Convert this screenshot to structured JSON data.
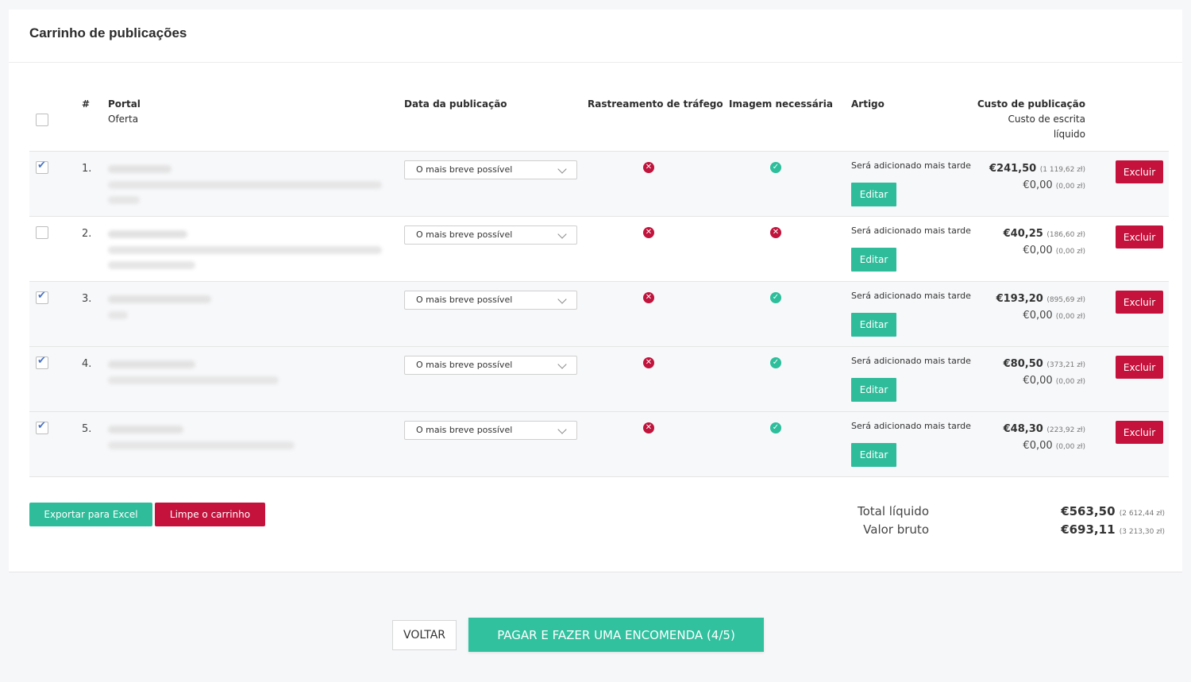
{
  "card": {
    "title": "Carrinho de publicações"
  },
  "headers": {
    "hash": "#",
    "portal": "Portal",
    "oferta": "Oferta",
    "date": "Data da publicação",
    "tracking": "Rastreamento de tráfego",
    "image": "Imagem necessária",
    "article": "Artigo",
    "cost": "Custo de publicação",
    "writing_cost": "Custo de escrita",
    "net": "líquido"
  },
  "rows": [
    {
      "checked": true,
      "num": "1.",
      "date": "O mais breve possível",
      "tracking": "no",
      "image": "yes",
      "article": "Será adicionado mais tarde",
      "edit": "Editar",
      "price": "€241,50",
      "price_pln": "(1 119,62 zł)",
      "writing": "€0,00",
      "writing_pln": "(0,00 zł)",
      "delete": "Excluir"
    },
    {
      "checked": false,
      "num": "2.",
      "date": "O mais breve possível",
      "tracking": "no",
      "image": "no",
      "article": "Será adicionado mais tarde",
      "edit": "Editar",
      "price": "€40,25",
      "price_pln": "(186,60 zł)",
      "writing": "€0,00",
      "writing_pln": "(0,00 zł)",
      "delete": "Excluir"
    },
    {
      "checked": true,
      "num": "3.",
      "date": "O mais breve possível",
      "tracking": "no",
      "image": "yes",
      "article": "Será adicionado mais tarde",
      "edit": "Editar",
      "price": "€193,20",
      "price_pln": "(895,69 zł)",
      "writing": "€0,00",
      "writing_pln": "(0,00 zł)",
      "delete": "Excluir"
    },
    {
      "checked": true,
      "num": "4.",
      "date": "O mais breve possível",
      "tracking": "no",
      "image": "yes",
      "article": "Será adicionado mais tarde",
      "edit": "Editar",
      "price": "€80,50",
      "price_pln": "(373,21 zł)",
      "writing": "€0,00",
      "writing_pln": "(0,00 zł)",
      "delete": "Excluir"
    },
    {
      "checked": true,
      "num": "5.",
      "date": "O mais breve possível",
      "tracking": "no",
      "image": "yes",
      "article": "Será adicionado mais tarde",
      "edit": "Editar",
      "price": "€48,30",
      "price_pln": "(223,92 zł)",
      "writing": "€0,00",
      "writing_pln": "(0,00 zł)",
      "delete": "Excluir"
    }
  ],
  "actions": {
    "export": "Exportar para Excel",
    "clear": "Limpe o carrinho"
  },
  "totals": {
    "net_label": "Total líquido",
    "net_value": "€563,50",
    "net_pln": "(2 612,44 zł)",
    "gross_label": "Valor bruto",
    "gross_value": "€693,11",
    "gross_pln": "(3 213,30 zł)"
  },
  "nav": {
    "back": "VOLTAR",
    "pay": "PAGAR E FAZER UMA ENCOMENDA (4/5)"
  },
  "colors": {
    "accent": "#2fbc9a",
    "danger": "#c4123c",
    "check": "#4a74c9"
  }
}
